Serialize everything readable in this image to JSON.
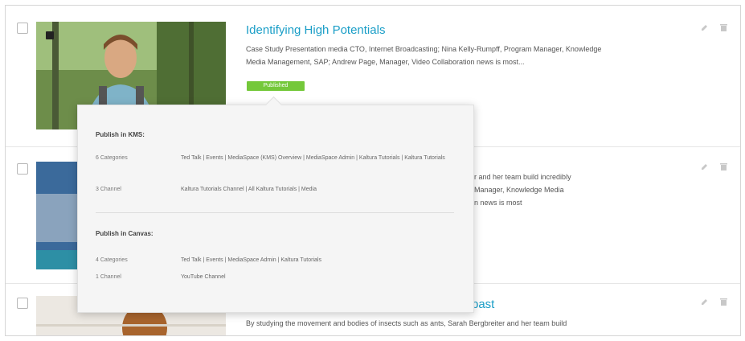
{
  "items": [
    {
      "title": "Identifying High Potentials",
      "description": "Case Study Presentation media CTO, Internet Broadcasting; Nina Kelly-Rumpff, Program Manager, Knowledge  Media Management, SAP; Andrew Page, Manager, Video Collaboration news is most...",
      "badge": "Published"
    },
    {
      "title": "",
      "description_fragments": [
        "r and her team build incredibly",
        "Manager, Knowledge  Media",
        "n news is most"
      ]
    },
    {
      "title_fragment": "past",
      "description": "By studying the movement and bodies of insects such as ants, Sarah Bergbreiter and her team build"
    }
  ],
  "popup": {
    "kms": {
      "heading": "Publish in KMS:",
      "categories_label": "6 Categories",
      "categories_value": "Ted Talk  |  Events  |  MediaSpace (KMS) Overview  |  MediaSpace Admin  |  Kaltura Tutorials  |  Kaltura Tutorials",
      "channels_label": "3 Channel",
      "channels_value": "Kaltura Tutorials Channel  |  All Kaltura Tutorials  |  Media"
    },
    "canvas": {
      "heading": "Publish in Canvas:",
      "categories_label": "4 Categories",
      "categories_value": "Ted Talk  |  Events  |  MediaSpace Admin  |  Kaltura Tutorials",
      "channels_label": "1 Channel",
      "channels_value": "YouTube Channel"
    }
  },
  "icons": [
    "edit-icon",
    "delete-icon",
    "media-type-icon"
  ],
  "colors": {
    "title": "#1a9ec7",
    "badge": "#74c83a"
  }
}
